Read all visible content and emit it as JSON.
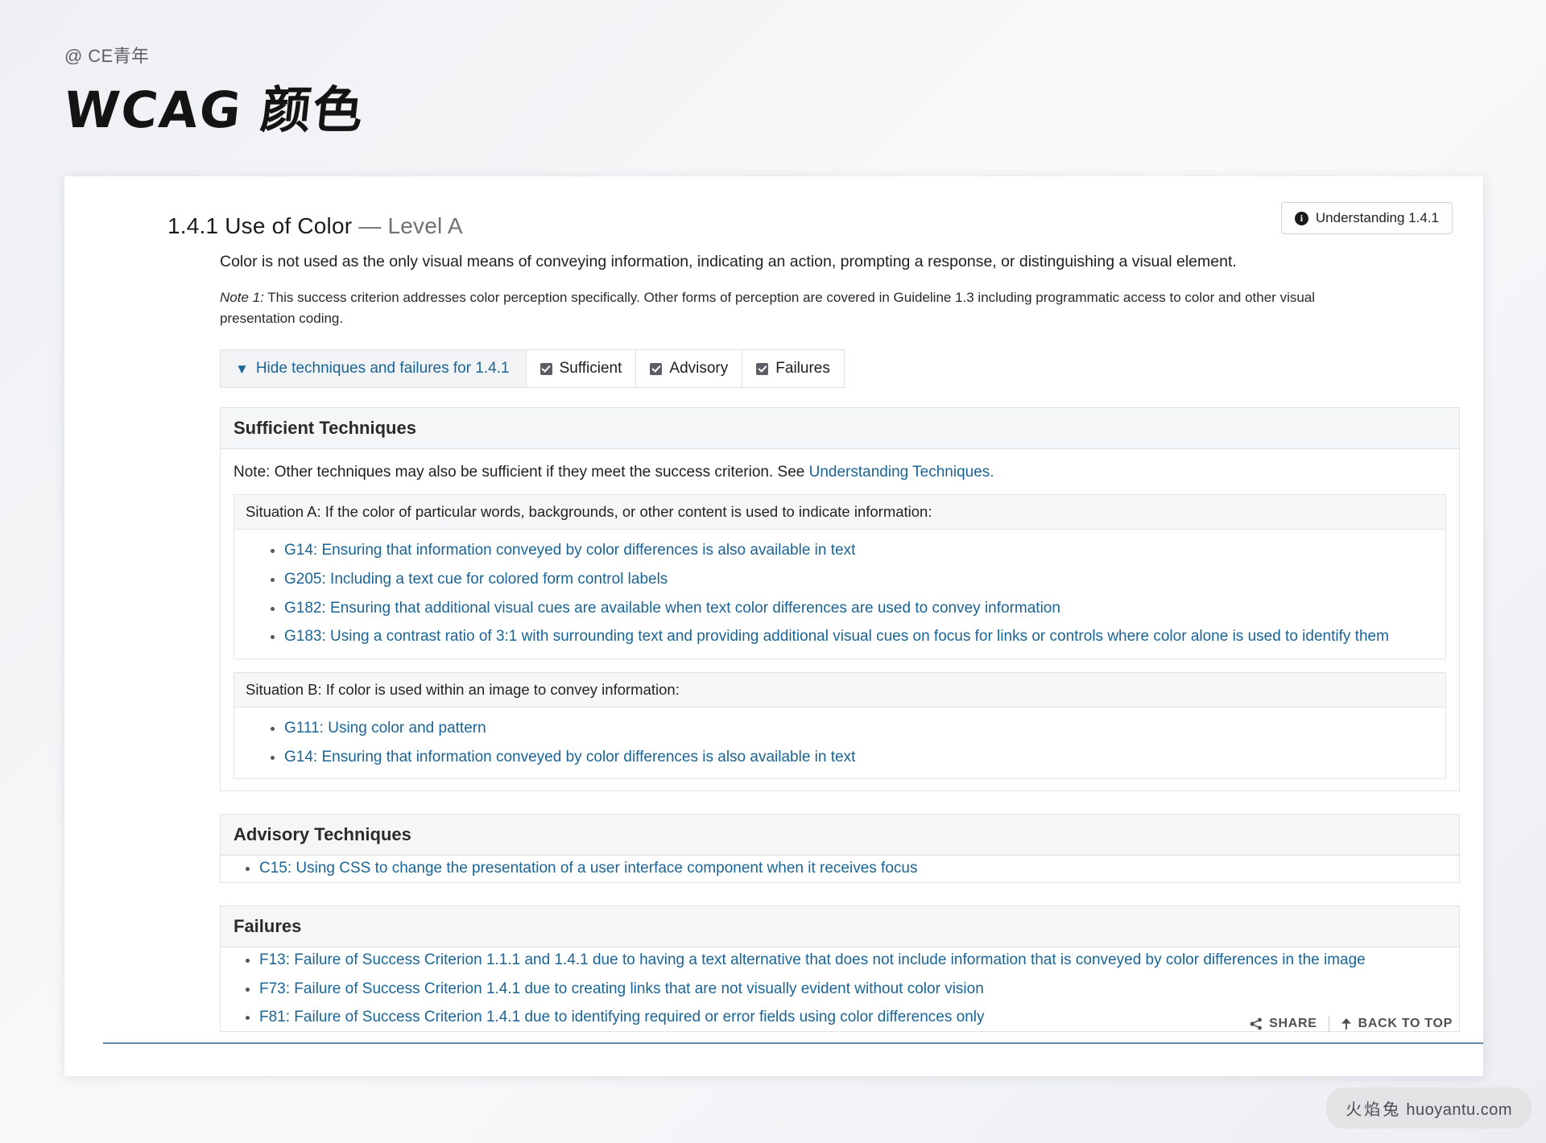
{
  "header": {
    "handle": "@ CE青年",
    "title": "WCAG 颜色"
  },
  "criterion": {
    "number_and_name": "1.4.1 Use of Color",
    "dash": "—",
    "level": "Level A",
    "description": "Color is not used as the only visual means of conveying information, indicating an action, prompting a response, or distinguishing a visual element.",
    "note_label": "Note 1:",
    "note_text": " This success criterion addresses color perception specifically. Other forms of perception are covered in Guideline 1.3 including programmatic access to color and other visual presentation coding.",
    "understanding_button": "Understanding 1.4.1",
    "understanding_icon": "info-icon"
  },
  "filters": {
    "toggle_label": "Hide techniques and failures for 1.4.1",
    "toggle_icon": "chevron-down-icon",
    "checkboxes": [
      {
        "label": "Sufficient",
        "checked": true
      },
      {
        "label": "Advisory",
        "checked": true
      },
      {
        "label": "Failures",
        "checked": true
      }
    ]
  },
  "sufficient": {
    "heading": "Sufficient Techniques",
    "note": "Note: Other techniques may also be sufficient if they meet the success criterion. See ",
    "note_link": "Understanding Techniques.",
    "situations": [
      {
        "heading": "Situation A: If the color of particular words, backgrounds, or other content is used to indicate information:",
        "items": [
          "G14: Ensuring that information conveyed by color differences is also available in text",
          "G205: Including a text cue for colored form control labels",
          "G182: Ensuring that additional visual cues are available when text color differences are used to convey information",
          "G183: Using a contrast ratio of 3:1 with surrounding text and providing additional visual cues on focus for links or controls where color alone is used to identify them"
        ]
      },
      {
        "heading": "Situation B: If color is used within an image to convey information:",
        "items": [
          "G111: Using color and pattern",
          "G14: Ensuring that information conveyed by color differences is also available in text"
        ]
      }
    ]
  },
  "advisory": {
    "heading": "Advisory Techniques",
    "items": [
      "C15: Using CSS to change the presentation of a user interface component when it receives focus"
    ]
  },
  "failures": {
    "heading": "Failures",
    "items": [
      "F13: Failure of Success Criterion 1.1.1 and 1.4.1 due to having a text alternative that does not include information that is conveyed by color differences in the image",
      "F73: Failure of Success Criterion 1.4.1 due to creating links that are not visually evident without color vision",
      "F81: Failure of Success Criterion 1.4.1 due to identifying required or error fields using color differences only"
    ]
  },
  "footer": {
    "share_label": "SHARE",
    "share_icon": "share-icon",
    "back_to_top_label": "BACK TO TOP",
    "back_to_top_icon": "arrow-up-icon"
  },
  "watermark": {
    "cn": "火焰兔",
    "domain": "huoyantu.com"
  },
  "colors": {
    "link": "#1a6496",
    "rule": "#5f8ba0",
    "checkbox": "#5c6066"
  }
}
